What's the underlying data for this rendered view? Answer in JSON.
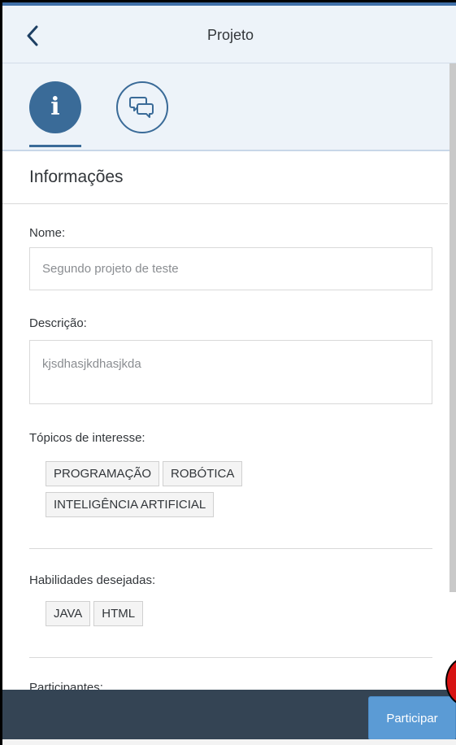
{
  "header": {
    "title": "Projeto",
    "back_icon": "chevron-left-icon"
  },
  "tabs": [
    {
      "name": "info",
      "icon": "info-icon",
      "glyph": "i",
      "selected": true
    },
    {
      "name": "comments",
      "icon": "chat-bubbles-icon",
      "selected": false
    }
  ],
  "section": {
    "title": "Informações"
  },
  "form": {
    "name_label": "Nome:",
    "name_value": "Segundo projeto de teste",
    "description_label": "Descrição:",
    "description_value": "kjsdhasjkdhasjkda",
    "topics_label": "Tópicos de interesse:",
    "topics": [
      "PROGRAMAÇÃO",
      "ROBÓTICA",
      "INTELIGÊNCIA ARTIFICIAL"
    ],
    "skills_label": "Habilidades desejadas:",
    "skills": [
      "JAVA",
      "HTML"
    ],
    "participants_label": "Participantes:"
  },
  "footer": {
    "participate_label": "Participar"
  },
  "colors": {
    "accent": "#3a6b98",
    "header_bg": "#edf3f9",
    "footer_bg": "#344454",
    "button": "#5b9bd5",
    "marker": "#d71313"
  }
}
